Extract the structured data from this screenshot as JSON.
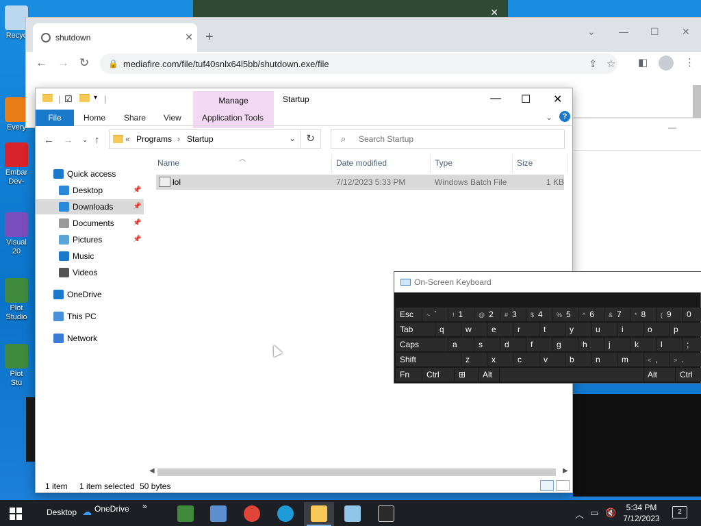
{
  "desktop": {
    "icons": [
      {
        "label": "Recyc",
        "color": "#bcd8ef"
      },
      {
        "label": "Every",
        "color": "#e87d18"
      },
      {
        "label": "Embar\nDev-",
        "color": "#d8232a"
      },
      {
        "label": "Visual\n20",
        "color": "#7c4dbf"
      },
      {
        "label": "Plot\nStudio",
        "color": "#3f8a3c"
      },
      {
        "label": "Plot\nStu",
        "color": "#3f8a3c"
      }
    ],
    "strip_close": "✕"
  },
  "chrome": {
    "tab_title": "shutdown",
    "tab_close": "✕",
    "new_tab": "+",
    "url": "mediafire.com/file/tuf40snlx64l5bb/shutdown.exe/file",
    "controls": {
      "chevron": "⌄",
      "minimize": "—",
      "maximize": "☐",
      "close": "✕"
    }
  },
  "explorer": {
    "window_title": "Startup",
    "manage_label": "Manage",
    "ribbon_tabs": {
      "file": "File",
      "home": "Home",
      "share": "Share",
      "view": "View",
      "app_tools": "Application Tools"
    },
    "help": "?",
    "breadcrumb": {
      "sep": "«",
      "programs": "Programs",
      "arrow": "›",
      "startup": "Startup"
    },
    "search_placeholder": "Search Startup",
    "sidebar": [
      {
        "label": "Quick access",
        "icon": "star-icon",
        "pinned": false
      },
      {
        "label": "Desktop",
        "icon": "desktop-icon",
        "pinned": true
      },
      {
        "label": "Downloads",
        "icon": "download-icon",
        "pinned": true,
        "selected": true
      },
      {
        "label": "Documents",
        "icon": "documents-icon",
        "pinned": true
      },
      {
        "label": "Pictures",
        "icon": "pictures-icon",
        "pinned": true
      },
      {
        "label": "Music",
        "icon": "music-icon",
        "pinned": false
      },
      {
        "label": "Videos",
        "icon": "videos-icon",
        "pinned": false
      },
      {
        "label": "OneDrive",
        "icon": "onedrive-icon",
        "pinned": false
      },
      {
        "label": "This PC",
        "icon": "this-pc-icon",
        "pinned": false
      },
      {
        "label": "Network",
        "icon": "network-icon",
        "pinned": false
      }
    ],
    "columns": {
      "name": "Name",
      "date": "Date modified",
      "type": "Type",
      "size": "Size"
    },
    "files": [
      {
        "name": "lol",
        "date": "7/12/2023 5:33 PM",
        "type": "Windows Batch File",
        "size": "1 KB"
      }
    ],
    "status": {
      "count": "1 item",
      "selected": "1 item selected",
      "bytes": "50 bytes"
    }
  },
  "osk": {
    "title": "On-Screen Keyboard",
    "rows": [
      [
        {
          "label": "Esc",
          "sub": ""
        },
        {
          "label": "`",
          "sub": "~"
        },
        {
          "label": "1",
          "sub": "!"
        },
        {
          "label": "2",
          "sub": "@"
        },
        {
          "label": "3",
          "sub": "#"
        },
        {
          "label": "4",
          "sub": "$"
        },
        {
          "label": "5",
          "sub": "%"
        },
        {
          "label": "6",
          "sub": "^"
        },
        {
          "label": "7",
          "sub": "&"
        },
        {
          "label": "8",
          "sub": "*"
        },
        {
          "label": "9",
          "sub": "("
        },
        {
          "label": "0",
          "sub": ""
        }
      ],
      [
        {
          "label": "Tab",
          "sub": ""
        },
        {
          "label": "q",
          "sub": ""
        },
        {
          "label": "w",
          "sub": ""
        },
        {
          "label": "e",
          "sub": ""
        },
        {
          "label": "r",
          "sub": ""
        },
        {
          "label": "t",
          "sub": ""
        },
        {
          "label": "y",
          "sub": ""
        },
        {
          "label": "u",
          "sub": ""
        },
        {
          "label": "i",
          "sub": ""
        },
        {
          "label": "o",
          "sub": ""
        },
        {
          "label": "p",
          "sub": ""
        }
      ],
      [
        {
          "label": "Caps",
          "sub": ""
        },
        {
          "label": "a",
          "sub": ""
        },
        {
          "label": "s",
          "sub": ""
        },
        {
          "label": "d",
          "sub": ""
        },
        {
          "label": "f",
          "sub": ""
        },
        {
          "label": "g",
          "sub": ""
        },
        {
          "label": "h",
          "sub": ""
        },
        {
          "label": "j",
          "sub": ""
        },
        {
          "label": "k",
          "sub": ""
        },
        {
          "label": "l",
          "sub": ""
        },
        {
          "label": ";",
          "sub": ""
        }
      ],
      [
        {
          "label": "Shift",
          "sub": ""
        },
        {
          "label": "z",
          "sub": ""
        },
        {
          "label": "x",
          "sub": ""
        },
        {
          "label": "c",
          "sub": ""
        },
        {
          "label": "v",
          "sub": ""
        },
        {
          "label": "b",
          "sub": ""
        },
        {
          "label": "n",
          "sub": ""
        },
        {
          "label": "m",
          "sub": ""
        },
        {
          "label": ",",
          "sub": "<"
        },
        {
          "label": ".",
          "sub": ">"
        }
      ],
      [
        {
          "label": "Fn",
          "sub": ""
        },
        {
          "label": "Ctrl",
          "sub": ""
        },
        {
          "label": "⊞",
          "sub": ""
        },
        {
          "label": "Alt",
          "sub": ""
        },
        {
          "label": "",
          "sub": ""
        },
        {
          "label": "Alt",
          "sub": ""
        },
        {
          "label": "Ctrl",
          "sub": ""
        }
      ]
    ]
  },
  "taskbar": {
    "desktop_label": "Desktop",
    "onedrive_label": "OneDrive",
    "overflow": "»",
    "apps": [
      {
        "name": "plot-studio",
        "color": "#3f8a3c",
        "active": false
      },
      {
        "name": "network-tool",
        "color": "#5b8fd1",
        "active": false
      },
      {
        "name": "chrome",
        "color": "#e0453a",
        "active": false
      },
      {
        "name": "edge",
        "color": "#1e9bd7",
        "active": false
      },
      {
        "name": "file-explorer",
        "color": "#f6c957",
        "active": true
      },
      {
        "name": "notepad",
        "color": "#8fc6e9",
        "active": false
      },
      {
        "name": "terminal",
        "color": "#2b2b2b",
        "active": false
      }
    ],
    "time": "5:34 PM",
    "date": "7/12/2023",
    "notification_count": "2"
  }
}
